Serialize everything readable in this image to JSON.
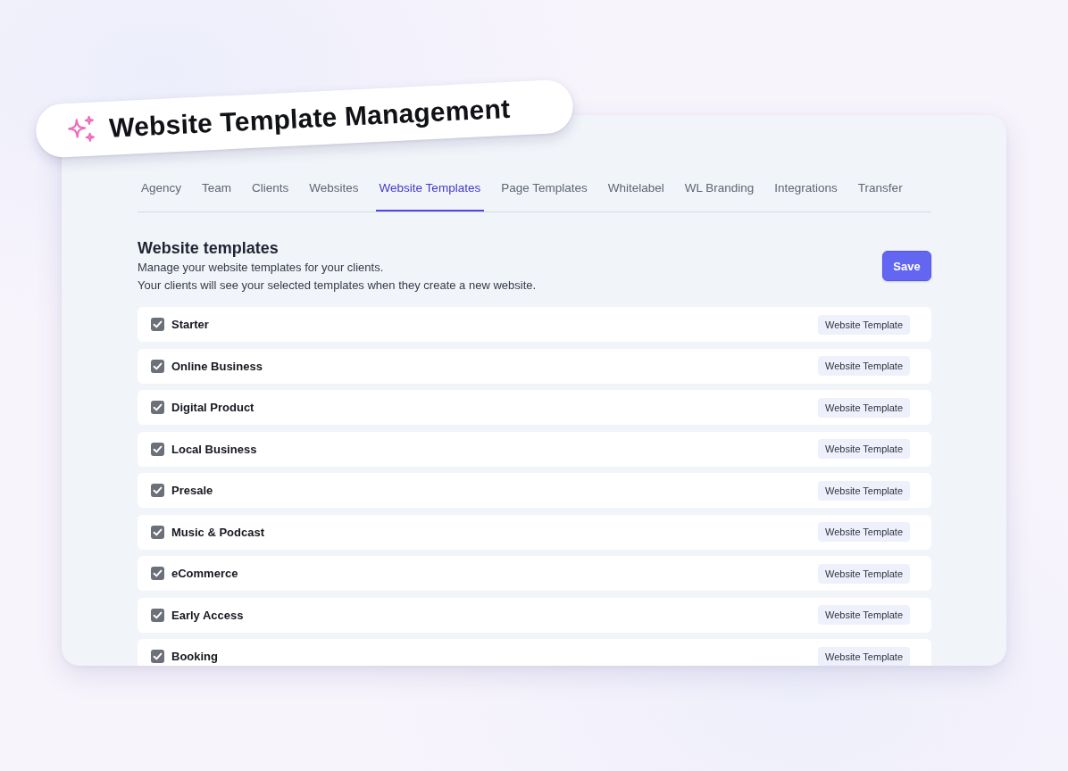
{
  "banner": {
    "title": "Website Template Management"
  },
  "tabs": [
    {
      "label": "Agency",
      "selected": false
    },
    {
      "label": "Team",
      "selected": false
    },
    {
      "label": "Clients",
      "selected": false
    },
    {
      "label": "Websites",
      "selected": false
    },
    {
      "label": "Website Templates",
      "selected": true
    },
    {
      "label": "Page Templates",
      "selected": false
    },
    {
      "label": "Whitelabel",
      "selected": false
    },
    {
      "label": "WL Branding",
      "selected": false
    },
    {
      "label": "Integrations",
      "selected": false
    },
    {
      "label": "Transfer",
      "selected": false
    }
  ],
  "section": {
    "title": "Website templates",
    "description_lines": [
      "Manage your website templates for your clients.",
      "Your clients will see your selected templates when they create a new website."
    ],
    "save_button": "Save"
  },
  "templates": [
    {
      "name": "Starter",
      "checked": true,
      "tag": "Website Template"
    },
    {
      "name": "Online Business",
      "checked": true,
      "tag": "Website Template"
    },
    {
      "name": "Digital Product",
      "checked": true,
      "tag": "Website Template"
    },
    {
      "name": "Local Business",
      "checked": true,
      "tag": "Website Template"
    },
    {
      "name": "Presale",
      "checked": true,
      "tag": "Website Template"
    },
    {
      "name": "Music & Podcast",
      "checked": true,
      "tag": "Website Template"
    },
    {
      "name": "eCommerce",
      "checked": true,
      "tag": "Website Template"
    },
    {
      "name": "Early Access",
      "checked": true,
      "tag": "Website Template"
    },
    {
      "name": "Booking",
      "checked": true,
      "tag": "Website Template"
    }
  ]
}
